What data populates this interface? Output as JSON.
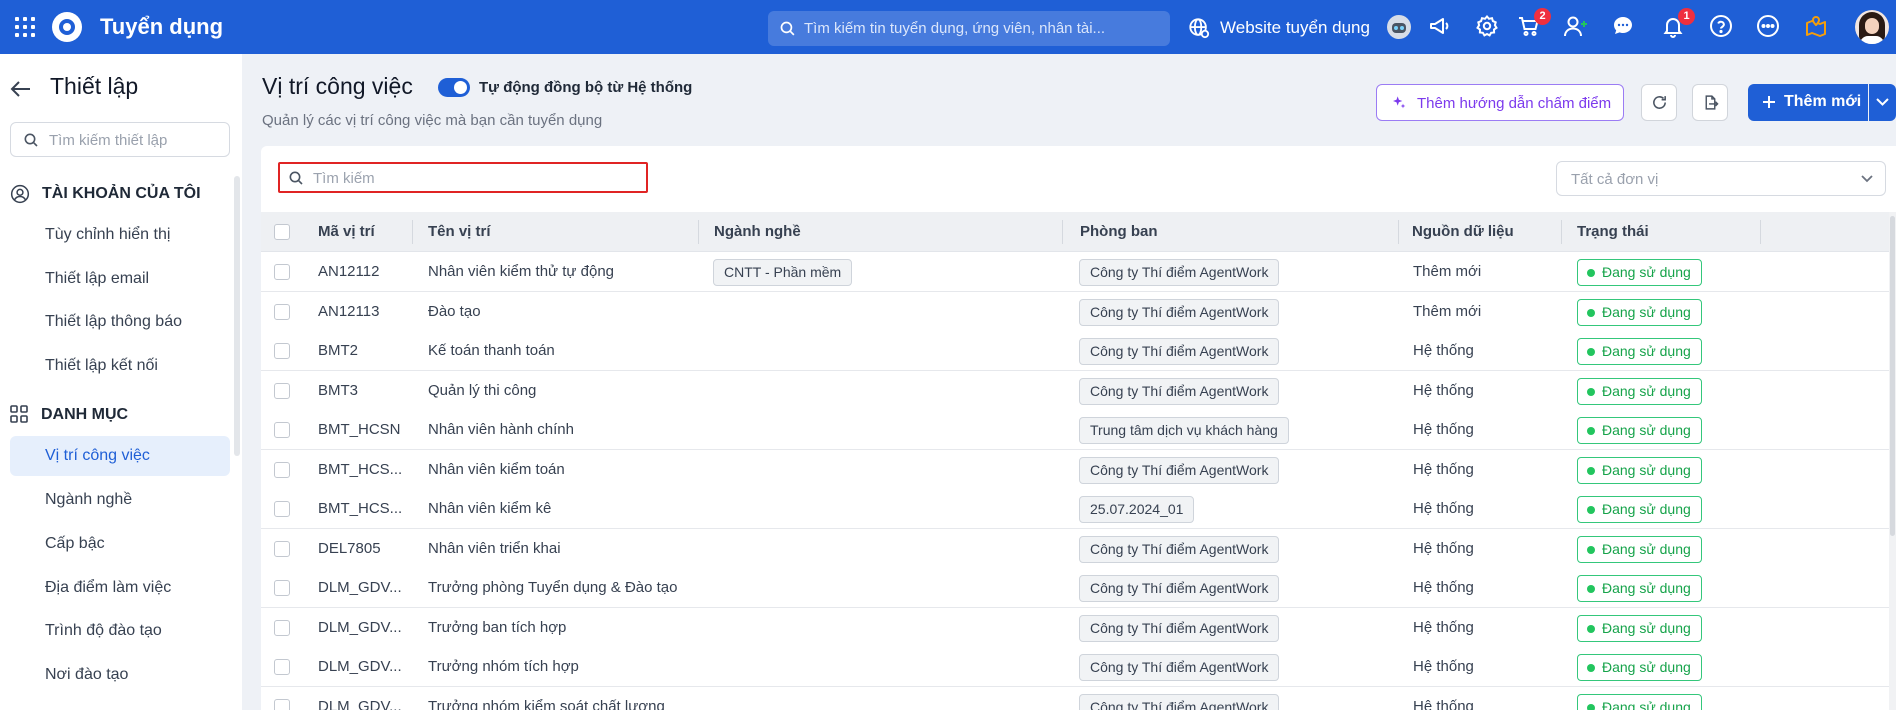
{
  "app": {
    "name": "Tuyển dụng"
  },
  "topbar": {
    "search_placeholder": "Tìm kiếm tin tuyển dụng, ứng viên, nhân tài...",
    "website_label": "Website tuyển dụng",
    "cart_badge": "2",
    "notification_badge": "1"
  },
  "sidebar": {
    "title": "Thiết lập",
    "search_placeholder": "Tìm kiếm thiết lập",
    "sections": [
      {
        "label": "TÀI KHOẢN CỦA TÔI",
        "icon": "user-circle-icon",
        "items": [
          "Tùy chỉnh hiển thị",
          "Thiết lập email",
          "Thiết lập thông báo",
          "Thiết lập kết nối"
        ]
      },
      {
        "label": "DANH MỤC",
        "icon": "grid-icon",
        "items": [
          "Vị trí công việc",
          "Ngành nghề",
          "Cấp bậc",
          "Địa điểm làm việc",
          "Trình độ đào tạo",
          "Nơi đào tạo"
        ]
      }
    ],
    "active_item": "Vị trí công việc"
  },
  "page": {
    "title": "Vị trí công việc",
    "toggle_label": "Tự động đồng bộ từ Hệ thống",
    "toggle_on": true,
    "subtitle": "Quản lý các vị trí công việc mà bạn cần tuyển dụng",
    "guide_button": "Thêm hướng dẫn chấm điểm",
    "add_button": "Thêm mới"
  },
  "table": {
    "search_placeholder": "Tìm kiếm",
    "unit_filter_placeholder": "Tất cả đơn vị",
    "columns": [
      "Mã vị trí",
      "Tên vị trí",
      "Ngành nghề",
      "Phòng ban",
      "Nguồn dữ liệu",
      "Trạng thái"
    ],
    "rows": [
      {
        "code": "AN12112",
        "name": "Nhân viên kiểm thử tự động",
        "industry": "CNTT - Phần mềm",
        "department": "Công ty Thí điểm AgentWork",
        "source": "Thêm mới",
        "status": "Đang sử dụng"
      },
      {
        "code": "AN12113",
        "name": "Đào tạo",
        "industry": "",
        "department": "Công ty Thí điểm AgentWork",
        "source": "Thêm mới",
        "status": "Đang sử dụng"
      },
      {
        "code": "BMT2",
        "name": "Kế toán thanh toán",
        "industry": "",
        "department": "Công ty Thí điểm AgentWork",
        "source": "Hệ thống",
        "status": "Đang sử dụng"
      },
      {
        "code": "BMT3",
        "name": "Quản lý thi công",
        "industry": "",
        "department": "Công ty Thí điểm AgentWork",
        "source": "Hệ thống",
        "status": "Đang sử dụng"
      },
      {
        "code": "BMT_HCSN",
        "name": "Nhân viên hành chính",
        "industry": "",
        "department": "Trung tâm dịch vụ khách hàng",
        "source": "Hệ thống",
        "status": "Đang sử dụng"
      },
      {
        "code": "BMT_HCS...",
        "name": "Nhân viên kiểm toán",
        "industry": "",
        "department": "Công ty Thí điểm AgentWork",
        "source": "Hệ thống",
        "status": "Đang sử dụng"
      },
      {
        "code": "BMT_HCS...",
        "name": "Nhân viên kiểm kê",
        "industry": "",
        "department": "25.07.2024_01",
        "source": "Hệ thống",
        "status": "Đang sử dụng"
      },
      {
        "code": "DEL7805",
        "name": "Nhân viên triển khai",
        "industry": "",
        "department": "Công ty Thí điểm AgentWork",
        "source": "Hệ thống",
        "status": "Đang sử dụng"
      },
      {
        "code": "DLM_GDV...",
        "name": "Trưởng phòng Tuyển dụng & Đào tạo",
        "industry": "",
        "department": "Công ty Thí điểm AgentWork",
        "source": "Hệ thống",
        "status": "Đang sử dụng"
      },
      {
        "code": "DLM_GDV...",
        "name": "Trưởng ban tích hợp",
        "industry": "",
        "department": "Công ty Thí điểm AgentWork",
        "source": "Hệ thống",
        "status": "Đang sử dụng"
      },
      {
        "code": "DLM_GDV...",
        "name": "Trưởng nhóm tích hợp",
        "industry": "",
        "department": "Công ty Thí điểm AgentWork",
        "source": "Hệ thống",
        "status": "Đang sử dụng"
      },
      {
        "code": "DLM_GDV...",
        "name": "Trưởng nhóm kiểm soát chất lượng",
        "industry": "",
        "department": "Công ty Thí điểm AgentWork",
        "source": "Hệ thống",
        "status": "Đang sử dụng"
      }
    ]
  },
  "colors": {
    "primary": "#1f5fd6",
    "active_bg": "#e6effc",
    "status_green": "#16a34a",
    "badge_red": "#ef2f3f",
    "guide_purple": "#7c3aed",
    "highlight_red": "#e02424"
  }
}
